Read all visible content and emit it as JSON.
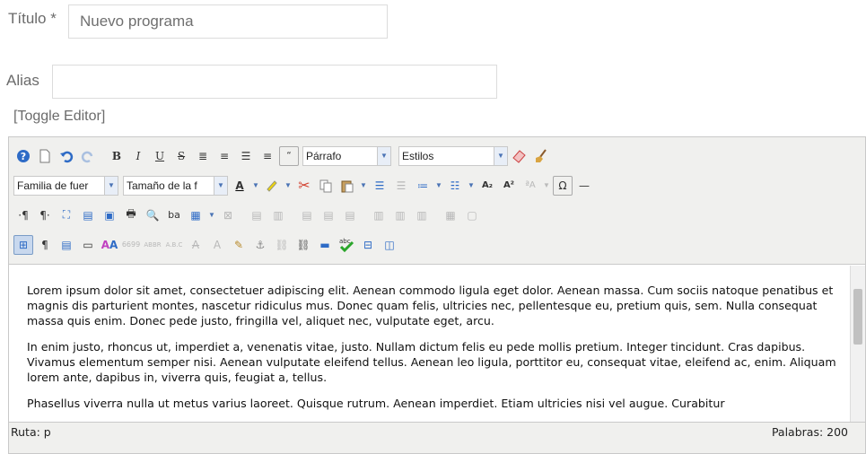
{
  "form": {
    "title_label": "Título *",
    "title_value": "Nuevo programa",
    "alias_label": "Alias",
    "alias_value": "",
    "toggle_editor": "[Toggle Editor]"
  },
  "toolbar": {
    "format_select": "Párrafo",
    "styles_select": "Estilos",
    "font_family_select": "Familia de fuer",
    "font_size_select": "Tamaño de la f"
  },
  "content": {
    "paragraphs": [
      "Lorem ipsum dolor sit amet, consectetuer adipiscing elit. Aenean commodo ligula eget dolor. Aenean massa. Cum sociis natoque penatibus et magnis dis parturient montes, nascetur ridiculus mus. Donec quam felis, ultricies nec, pellentesque eu, pretium quis, sem. Nulla consequat massa quis enim. Donec pede justo, fringilla vel, aliquet nec, vulputate eget, arcu.",
      "In enim justo, rhoncus ut, imperdiet a, venenatis vitae, justo. Nullam dictum felis eu pede mollis pretium. Integer tincidunt. Cras dapibus. Vivamus elementum semper nisi. Aenean vulputate eleifend tellus. Aenean leo ligula, porttitor eu, consequat vitae, eleifend ac, enim. Aliquam lorem ante, dapibus in, viverra quis, feugiat a, tellus.",
      "Phasellus viverra nulla ut metus varius laoreet. Quisque rutrum. Aenean imperdiet. Etiam ultricies nisi vel augue. Curabitur"
    ]
  },
  "status": {
    "path": "Ruta: p",
    "word_count": "Palabras: 200"
  }
}
